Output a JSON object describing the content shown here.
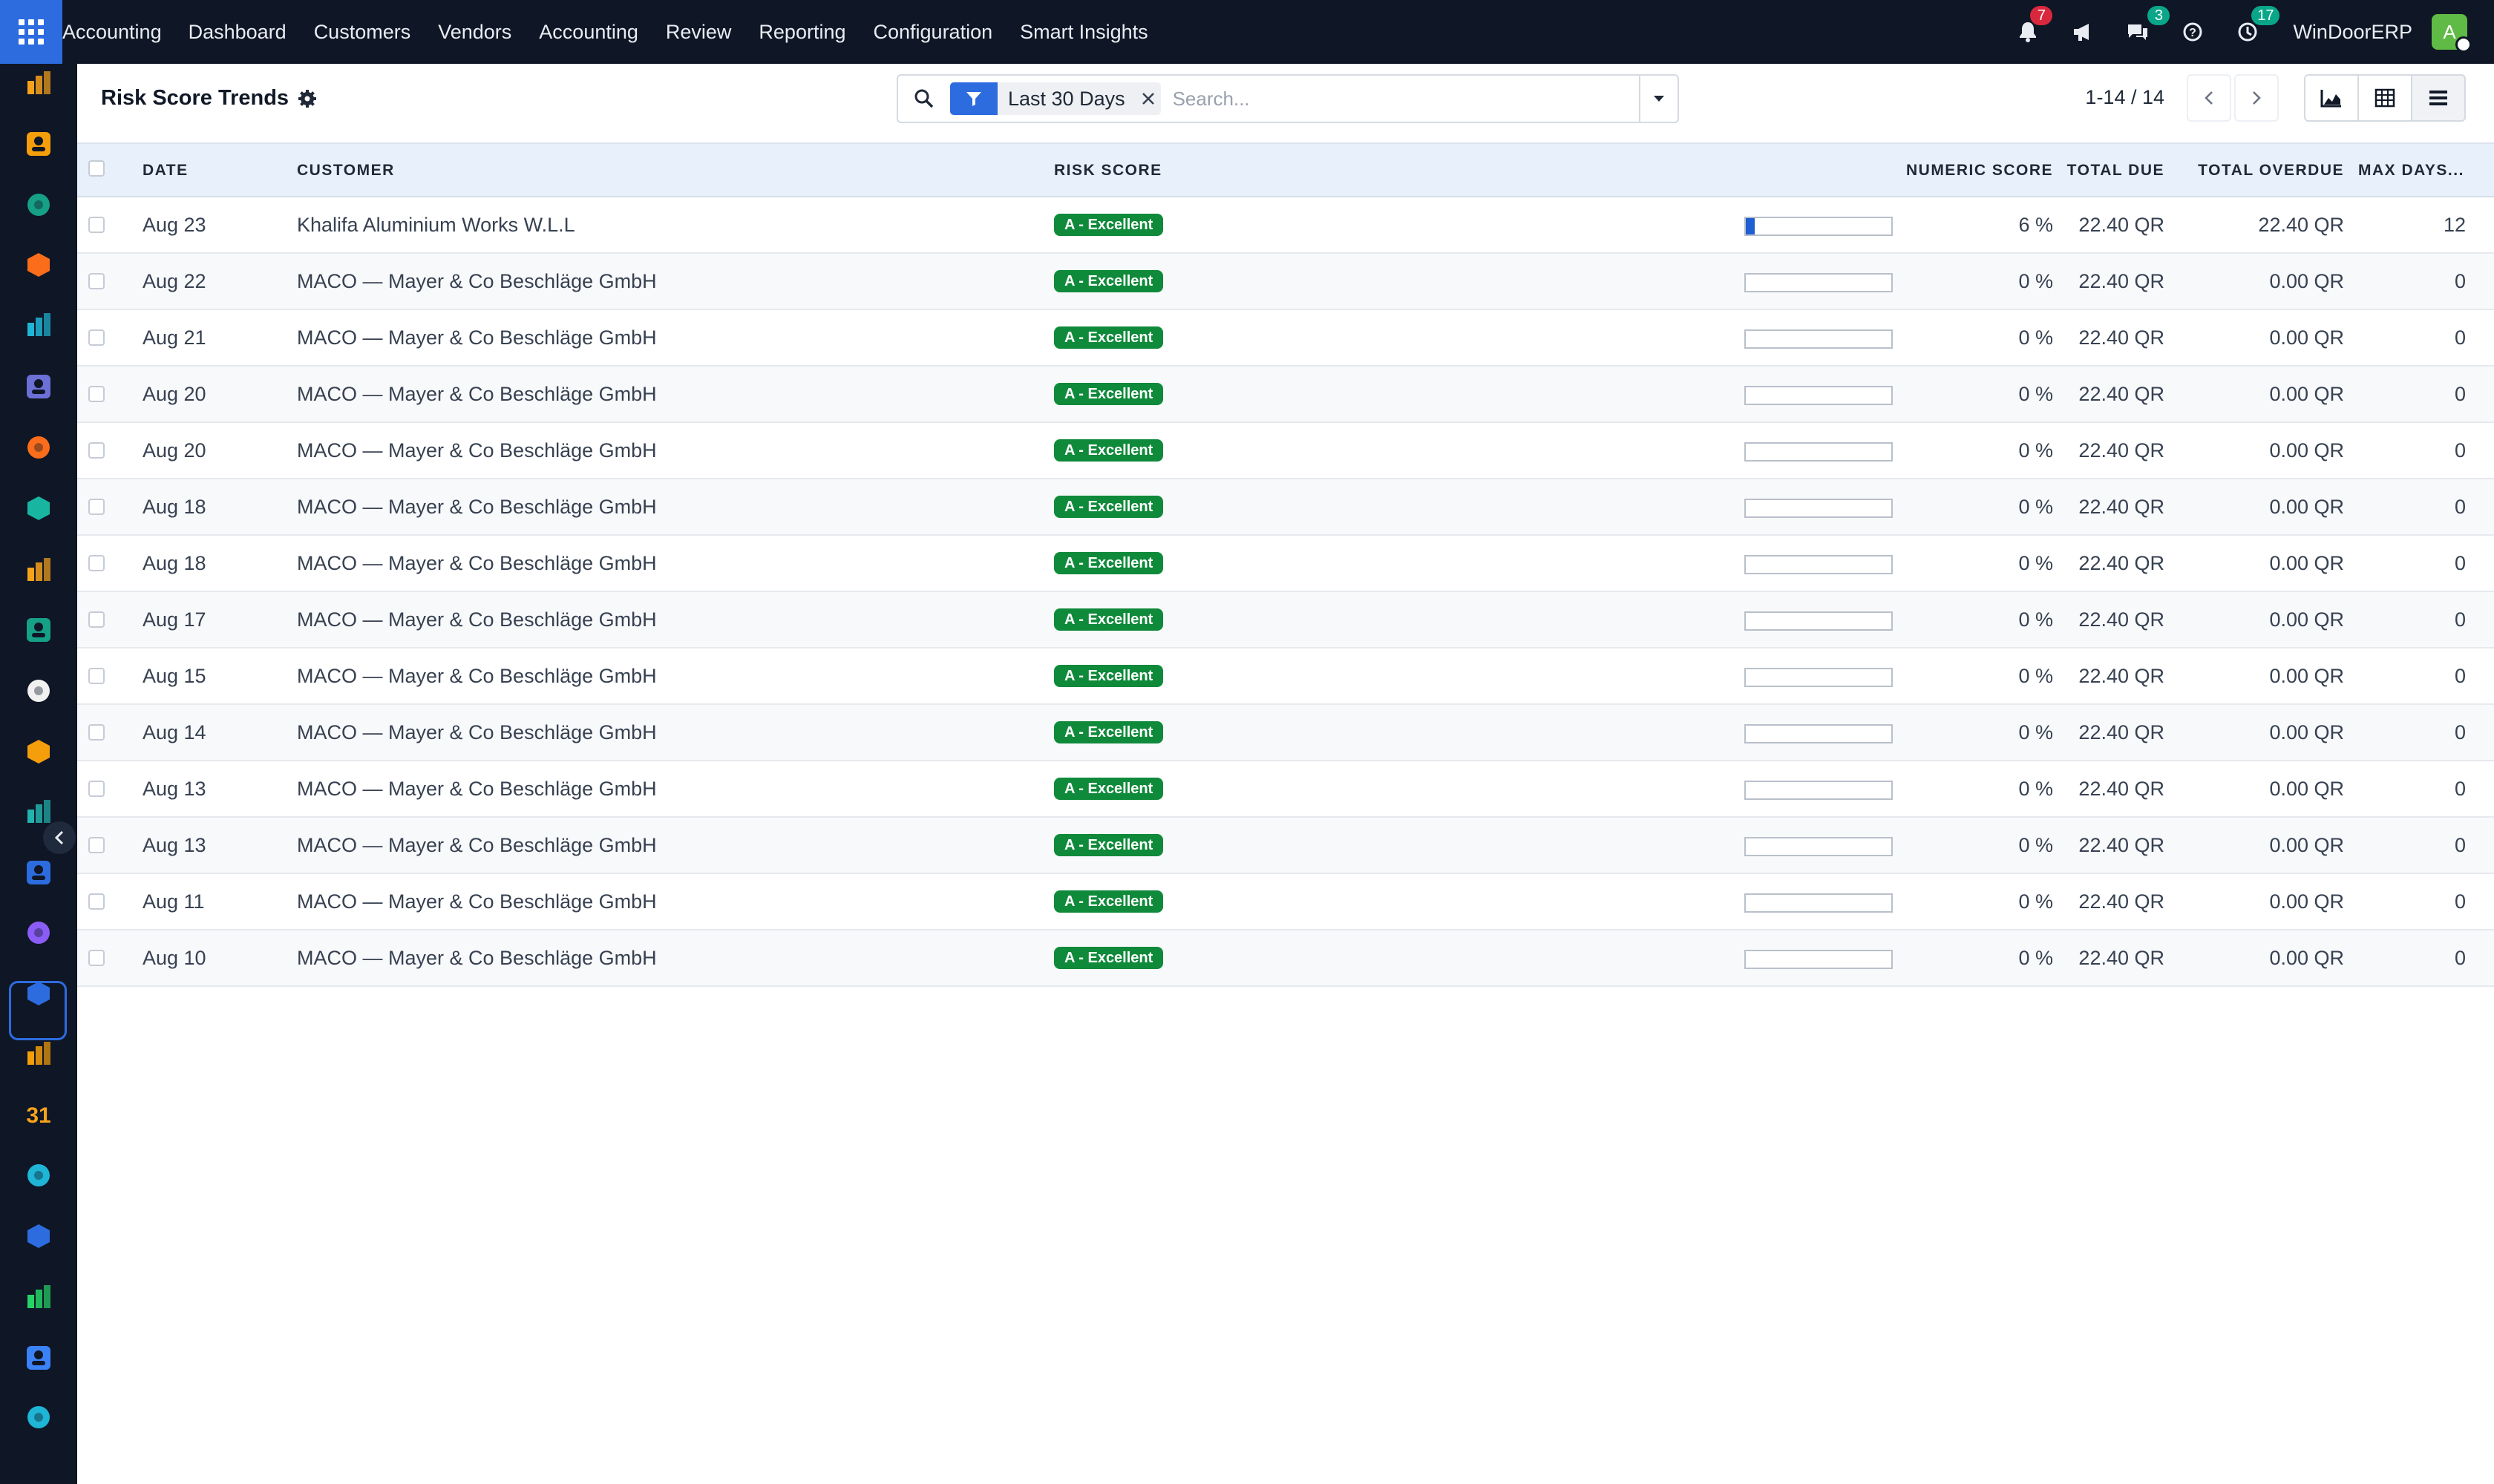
{
  "topbar": {
    "brand": "Accounting",
    "menu": [
      "Dashboard",
      "Customers",
      "Vendors",
      "Accounting",
      "Review",
      "Reporting",
      "Configuration",
      "Smart Insights"
    ],
    "notifications_count": "7",
    "messages_count": "3",
    "activities_count": "17",
    "company": "WinDoorERP",
    "avatar_initial": "A"
  },
  "sidebar": {
    "icons": [
      "bar-chart-app-icon",
      "photo-app-icon",
      "contacts-app-icon",
      "chat-app-icon",
      "waves-app-icon",
      "mail-app-icon",
      "discuss-app-icon",
      "vee-app-icon",
      "inventory-app-icon",
      "employees-app-icon",
      "cube-app-icon",
      "paint-app-icon",
      "check-app-icon",
      "knowledge-app-icon",
      "package-app-icon",
      "invoice-app-icon",
      "people-app-icon",
      "calendar-app-icon",
      "sign-app-icon",
      "dashboard-app-icon",
      "whatsapp-app-icon",
      "timer-app-icon",
      "waves2-app-icon"
    ],
    "calendar_day": "31"
  },
  "control": {
    "title": "Risk Score Trends",
    "facet_label": "Last 30 Days",
    "search_placeholder": "Search...",
    "pager": "1-14 / 14"
  },
  "table": {
    "columns": {
      "date": "DATE",
      "customer": "CUSTOMER",
      "risk": "RISK SCORE",
      "numeric": "NUMERIC SCORE",
      "due": "TOTAL DUE",
      "overdue": "TOTAL OVERDUE",
      "maxdays": "MAX DAYS..."
    },
    "rows": [
      {
        "date": "Aug 23",
        "customer": "Khalifa Aluminium Works W.L.L",
        "risk": "A - Excellent",
        "score": 6,
        "score_label": "6 %",
        "due": "22.40 QR",
        "overdue": "22.40 QR",
        "maxdays": "12"
      },
      {
        "date": "Aug 22",
        "customer": "MACO — Mayer & Co Beschläge GmbH",
        "risk": "A - Excellent",
        "score": 0,
        "score_label": "0 %",
        "due": "22.40 QR",
        "overdue": "0.00 QR",
        "maxdays": "0"
      },
      {
        "date": "Aug 21",
        "customer": "MACO — Mayer & Co Beschläge GmbH",
        "risk": "A - Excellent",
        "score": 0,
        "score_label": "0 %",
        "due": "22.40 QR",
        "overdue": "0.00 QR",
        "maxdays": "0"
      },
      {
        "date": "Aug 20",
        "customer": "MACO — Mayer & Co Beschläge GmbH",
        "risk": "A - Excellent",
        "score": 0,
        "score_label": "0 %",
        "due": "22.40 QR",
        "overdue": "0.00 QR",
        "maxdays": "0"
      },
      {
        "date": "Aug 20",
        "customer": "MACO — Mayer & Co Beschläge GmbH",
        "risk": "A - Excellent",
        "score": 0,
        "score_label": "0 %",
        "due": "22.40 QR",
        "overdue": "0.00 QR",
        "maxdays": "0"
      },
      {
        "date": "Aug 18",
        "customer": "MACO — Mayer & Co Beschläge GmbH",
        "risk": "A - Excellent",
        "score": 0,
        "score_label": "0 %",
        "due": "22.40 QR",
        "overdue": "0.00 QR",
        "maxdays": "0"
      },
      {
        "date": "Aug 18",
        "customer": "MACO — Mayer & Co Beschläge GmbH",
        "risk": "A - Excellent",
        "score": 0,
        "score_label": "0 %",
        "due": "22.40 QR",
        "overdue": "0.00 QR",
        "maxdays": "0"
      },
      {
        "date": "Aug 17",
        "customer": "MACO — Mayer & Co Beschläge GmbH",
        "risk": "A - Excellent",
        "score": 0,
        "score_label": "0 %",
        "due": "22.40 QR",
        "overdue": "0.00 QR",
        "maxdays": "0"
      },
      {
        "date": "Aug 15",
        "customer": "MACO — Mayer & Co Beschläge GmbH",
        "risk": "A - Excellent",
        "score": 0,
        "score_label": "0 %",
        "due": "22.40 QR",
        "overdue": "0.00 QR",
        "maxdays": "0"
      },
      {
        "date": "Aug 14",
        "customer": "MACO — Mayer & Co Beschläge GmbH",
        "risk": "A - Excellent",
        "score": 0,
        "score_label": "0 %",
        "due": "22.40 QR",
        "overdue": "0.00 QR",
        "maxdays": "0"
      },
      {
        "date": "Aug 13",
        "customer": "MACO — Mayer & Co Beschläge GmbH",
        "risk": "A - Excellent",
        "score": 0,
        "score_label": "0 %",
        "due": "22.40 QR",
        "overdue": "0.00 QR",
        "maxdays": "0"
      },
      {
        "date": "Aug 13",
        "customer": "MACO — Mayer & Co Beschläge GmbH",
        "risk": "A - Excellent",
        "score": 0,
        "score_label": "0 %",
        "due": "22.40 QR",
        "overdue": "0.00 QR",
        "maxdays": "0"
      },
      {
        "date": "Aug 11",
        "customer": "MACO — Mayer & Co Beschläge GmbH",
        "risk": "A - Excellent",
        "score": 0,
        "score_label": "0 %",
        "due": "22.40 QR",
        "overdue": "0.00 QR",
        "maxdays": "0"
      },
      {
        "date": "Aug 10",
        "customer": "MACO — Mayer & Co Beschläge GmbH",
        "risk": "A - Excellent",
        "score": 0,
        "score_label": "0 %",
        "due": "22.40 QR",
        "overdue": "0.00 QR",
        "maxdays": "0"
      }
    ]
  },
  "colors": {
    "topbar_bg": "#0f1625",
    "accent": "#2d6cdf",
    "risk_excellent": "#0f8a3a",
    "header_bg": "#e8f0fb",
    "score_bar": "#1f5fd1"
  }
}
